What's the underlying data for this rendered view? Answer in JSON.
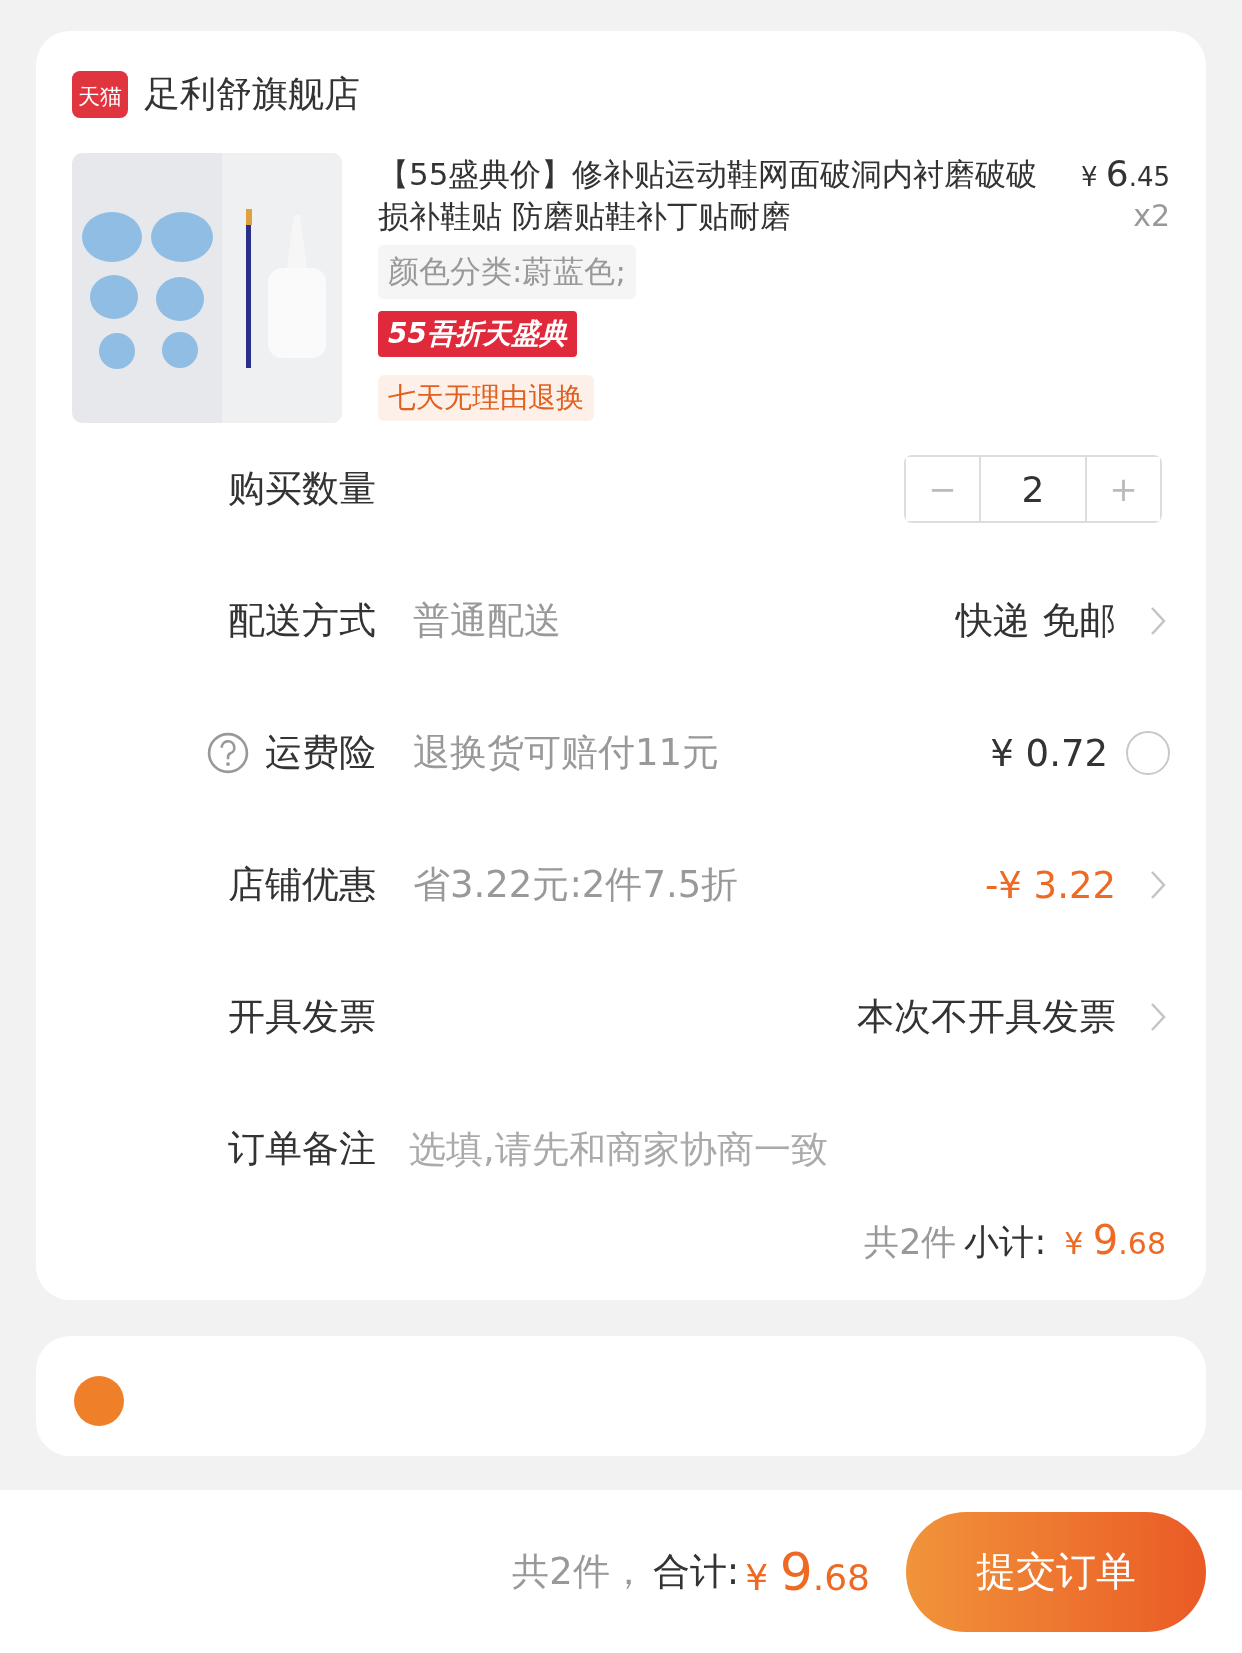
{
  "store": {
    "name": "足利舒旗舰店",
    "logo": "天猫"
  },
  "product": {
    "title": "【55盛典价】修补贴运动鞋网面破洞内衬磨破破损补鞋贴 防磨贴鞋补丁贴耐磨",
    "price": "¥ 6.45",
    "quantity": "x2",
    "spec": "颜色分类:蔚蓝色;",
    "promo_badge": "55吾折天盛典",
    "service_tag": "七天无理由退换"
  },
  "rows": [
    {
      "kind": "stepper",
      "label": "购买数量",
      "minus": "−",
      "value": "2",
      "plus": "+"
    },
    {
      "kind": "link",
      "label": "配送方式",
      "detail": "普通配送",
      "value": "快递 免邮",
      "accent": false
    },
    {
      "kind": "toggle",
      "label": "运费险",
      "detail": "退换货可赔付11元",
      "value": "¥ 0.72",
      "checked": false
    },
    {
      "kind": "link",
      "label": "店铺优惠",
      "detail": "省3.22元:2件7.5折",
      "value": "-¥ 3.22",
      "accent": true
    },
    {
      "kind": "link",
      "label": "开具发票",
      "value": "本次不开具发票",
      "accent": false
    },
    {
      "kind": "field",
      "label": "订单备注",
      "placeholder": "选填,请先和商家协商一致"
    }
  ],
  "subtotal": {
    "count": "共2件",
    "label": "小计:",
    "amount": "¥ 9.68"
  },
  "footer": {
    "count": "共2件，",
    "label": "合计:",
    "amount": "¥ 9.68",
    "submit": "提交订单"
  }
}
